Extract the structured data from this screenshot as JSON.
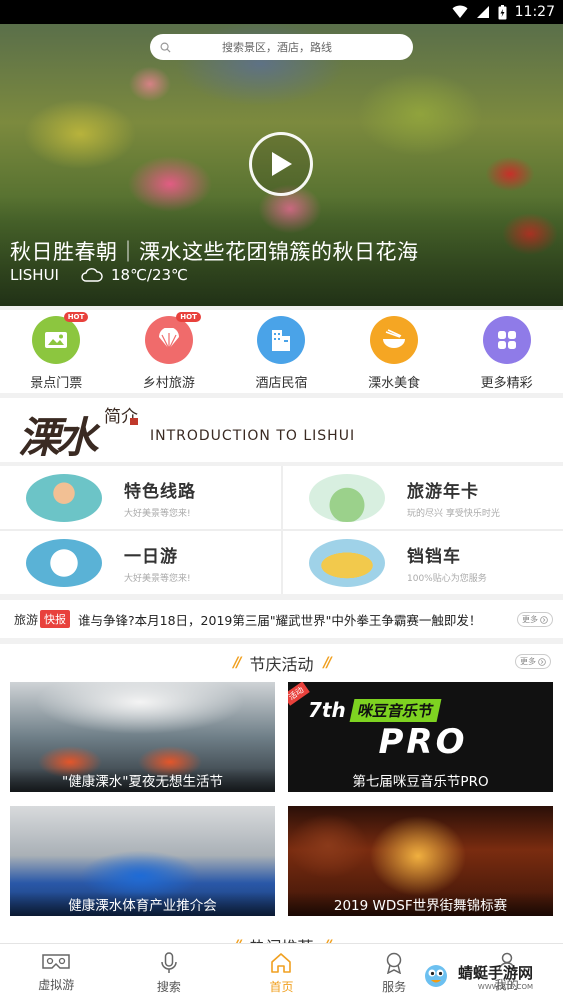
{
  "status_bar": {
    "time": "11:27"
  },
  "search": {
    "placeholder": "搜索景区，酒店，路线"
  },
  "hero": {
    "title": "秋日胜春朝｜溧水这些花团锦簇的秋日花海",
    "location": "LISHUI",
    "weather": "18℃/23℃"
  },
  "categories": [
    {
      "label": "景点门票",
      "icon": "ticket-icon",
      "color": "#8cc63f",
      "hot": "HOT"
    },
    {
      "label": "乡村旅游",
      "icon": "fan-icon",
      "color": "#f06b6b",
      "hot": "HOT"
    },
    {
      "label": "酒店民宿",
      "icon": "building-icon",
      "color": "#4aa3e8"
    },
    {
      "label": "溧水美食",
      "icon": "bowl-icon",
      "color": "#f5a623"
    },
    {
      "label": "更多精彩",
      "icon": "grid-icon",
      "color": "#8f7be8"
    }
  ],
  "intro": {
    "calligraphy": "溧水",
    "subtitle": "简介",
    "english": "INTRODUCTION TO LISHUI"
  },
  "features": [
    {
      "title": "特色线路",
      "subtitle": "大好美景等您来!"
    },
    {
      "title": "旅游年卡",
      "subtitle": "玩的尽兴 享受快乐时光"
    },
    {
      "title": "一日游",
      "subtitle": "大好美景等您来!"
    },
    {
      "title": "铛铛车",
      "subtitle": "100%贴心为您服务"
    }
  ],
  "ticker": {
    "source": "旅游",
    "tag": "快报",
    "headline": "谁与争锋?本月18日，2019第三届\"耀武世界\"中外拳王争霸赛一触即发！",
    "more": "更多"
  },
  "festival": {
    "title": "节庆活动",
    "more": "更多",
    "cards": [
      {
        "caption": "\"健康溧水\"夏夜无想生活节"
      },
      {
        "caption": "第七届咪豆音乐节PRO",
        "badge": "活动",
        "poster_line1": "7th",
        "poster_line2": "咪豆音乐节",
        "poster_line3": "PRO"
      },
      {
        "caption": "健康溧水体育产业推介会"
      },
      {
        "caption": "2019 WDSF世界街舞锦标赛"
      }
    ]
  },
  "next_section": {
    "title": "热门推荐"
  },
  "bottom_nav": [
    {
      "label": "虚拟游",
      "icon": "vr-icon"
    },
    {
      "label": "搜索",
      "icon": "microphone-icon"
    },
    {
      "label": "首页",
      "icon": "home-icon",
      "active": true
    },
    {
      "label": "服务",
      "icon": "award-icon"
    },
    {
      "label": "我的",
      "icon": "user-icon"
    }
  ],
  "watermark": {
    "text": "蜻蜓手游网",
    "url": "WWW.QT6.COM"
  },
  "colors": {
    "accent": "#f0a020",
    "hot_red": "#e8413c"
  }
}
